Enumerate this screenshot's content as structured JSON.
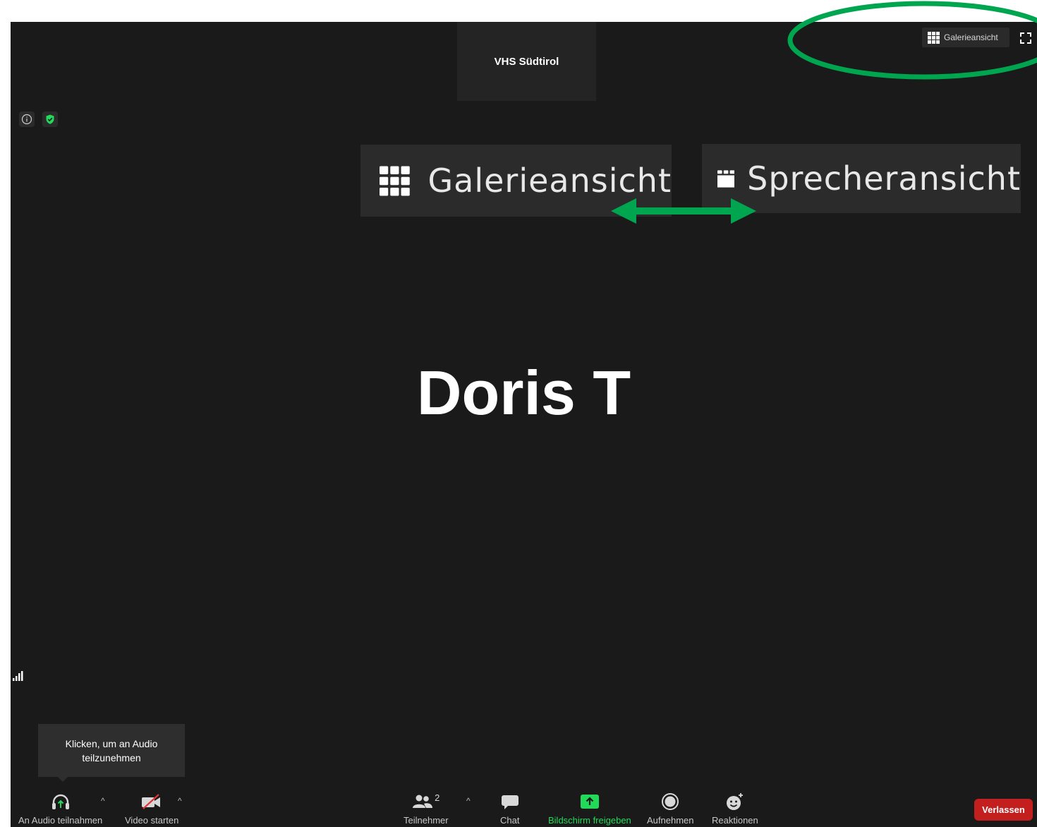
{
  "meeting": {
    "host_name": "VHS Südtirol",
    "participant_name": "Doris T",
    "view_button_label": "Galerieansicht"
  },
  "view_tiles": {
    "gallery_label": "Galerieansicht",
    "speaker_label": "Sprecheransicht"
  },
  "tooltip": {
    "text_line1": "Klicken, um an Audio",
    "text_line2": "teilzunehmen"
  },
  "toolbar": {
    "audio_label": "An Audio teilnahmen",
    "video_label": "Video starten",
    "participants_label": "Teilnehmer",
    "participants_count": "2",
    "chat_label": "Chat",
    "share_label": "Bildschirm freigeben",
    "record_label": "Aufnehmen",
    "reactions_label": "Reaktionen",
    "leave_label": "Verlassen"
  },
  "colors": {
    "window_bg": "#1a1a1a",
    "annotation_green": "#00a550",
    "share_green": "#23d959",
    "leave_red": "#c41f1f"
  },
  "icons": {
    "info": "info-icon",
    "security": "shield-icon",
    "grid": "grid-icon",
    "fullscreen": "fullscreen-icon",
    "speaker_view": "speaker-view-icon",
    "signal": "signal-icon",
    "headphones": "headphones-icon",
    "video_off": "video-off-icon",
    "participants": "participants-icon",
    "chat": "chat-bubble-icon",
    "share": "share-screen-icon",
    "record": "record-icon",
    "reactions": "reactions-icon"
  }
}
